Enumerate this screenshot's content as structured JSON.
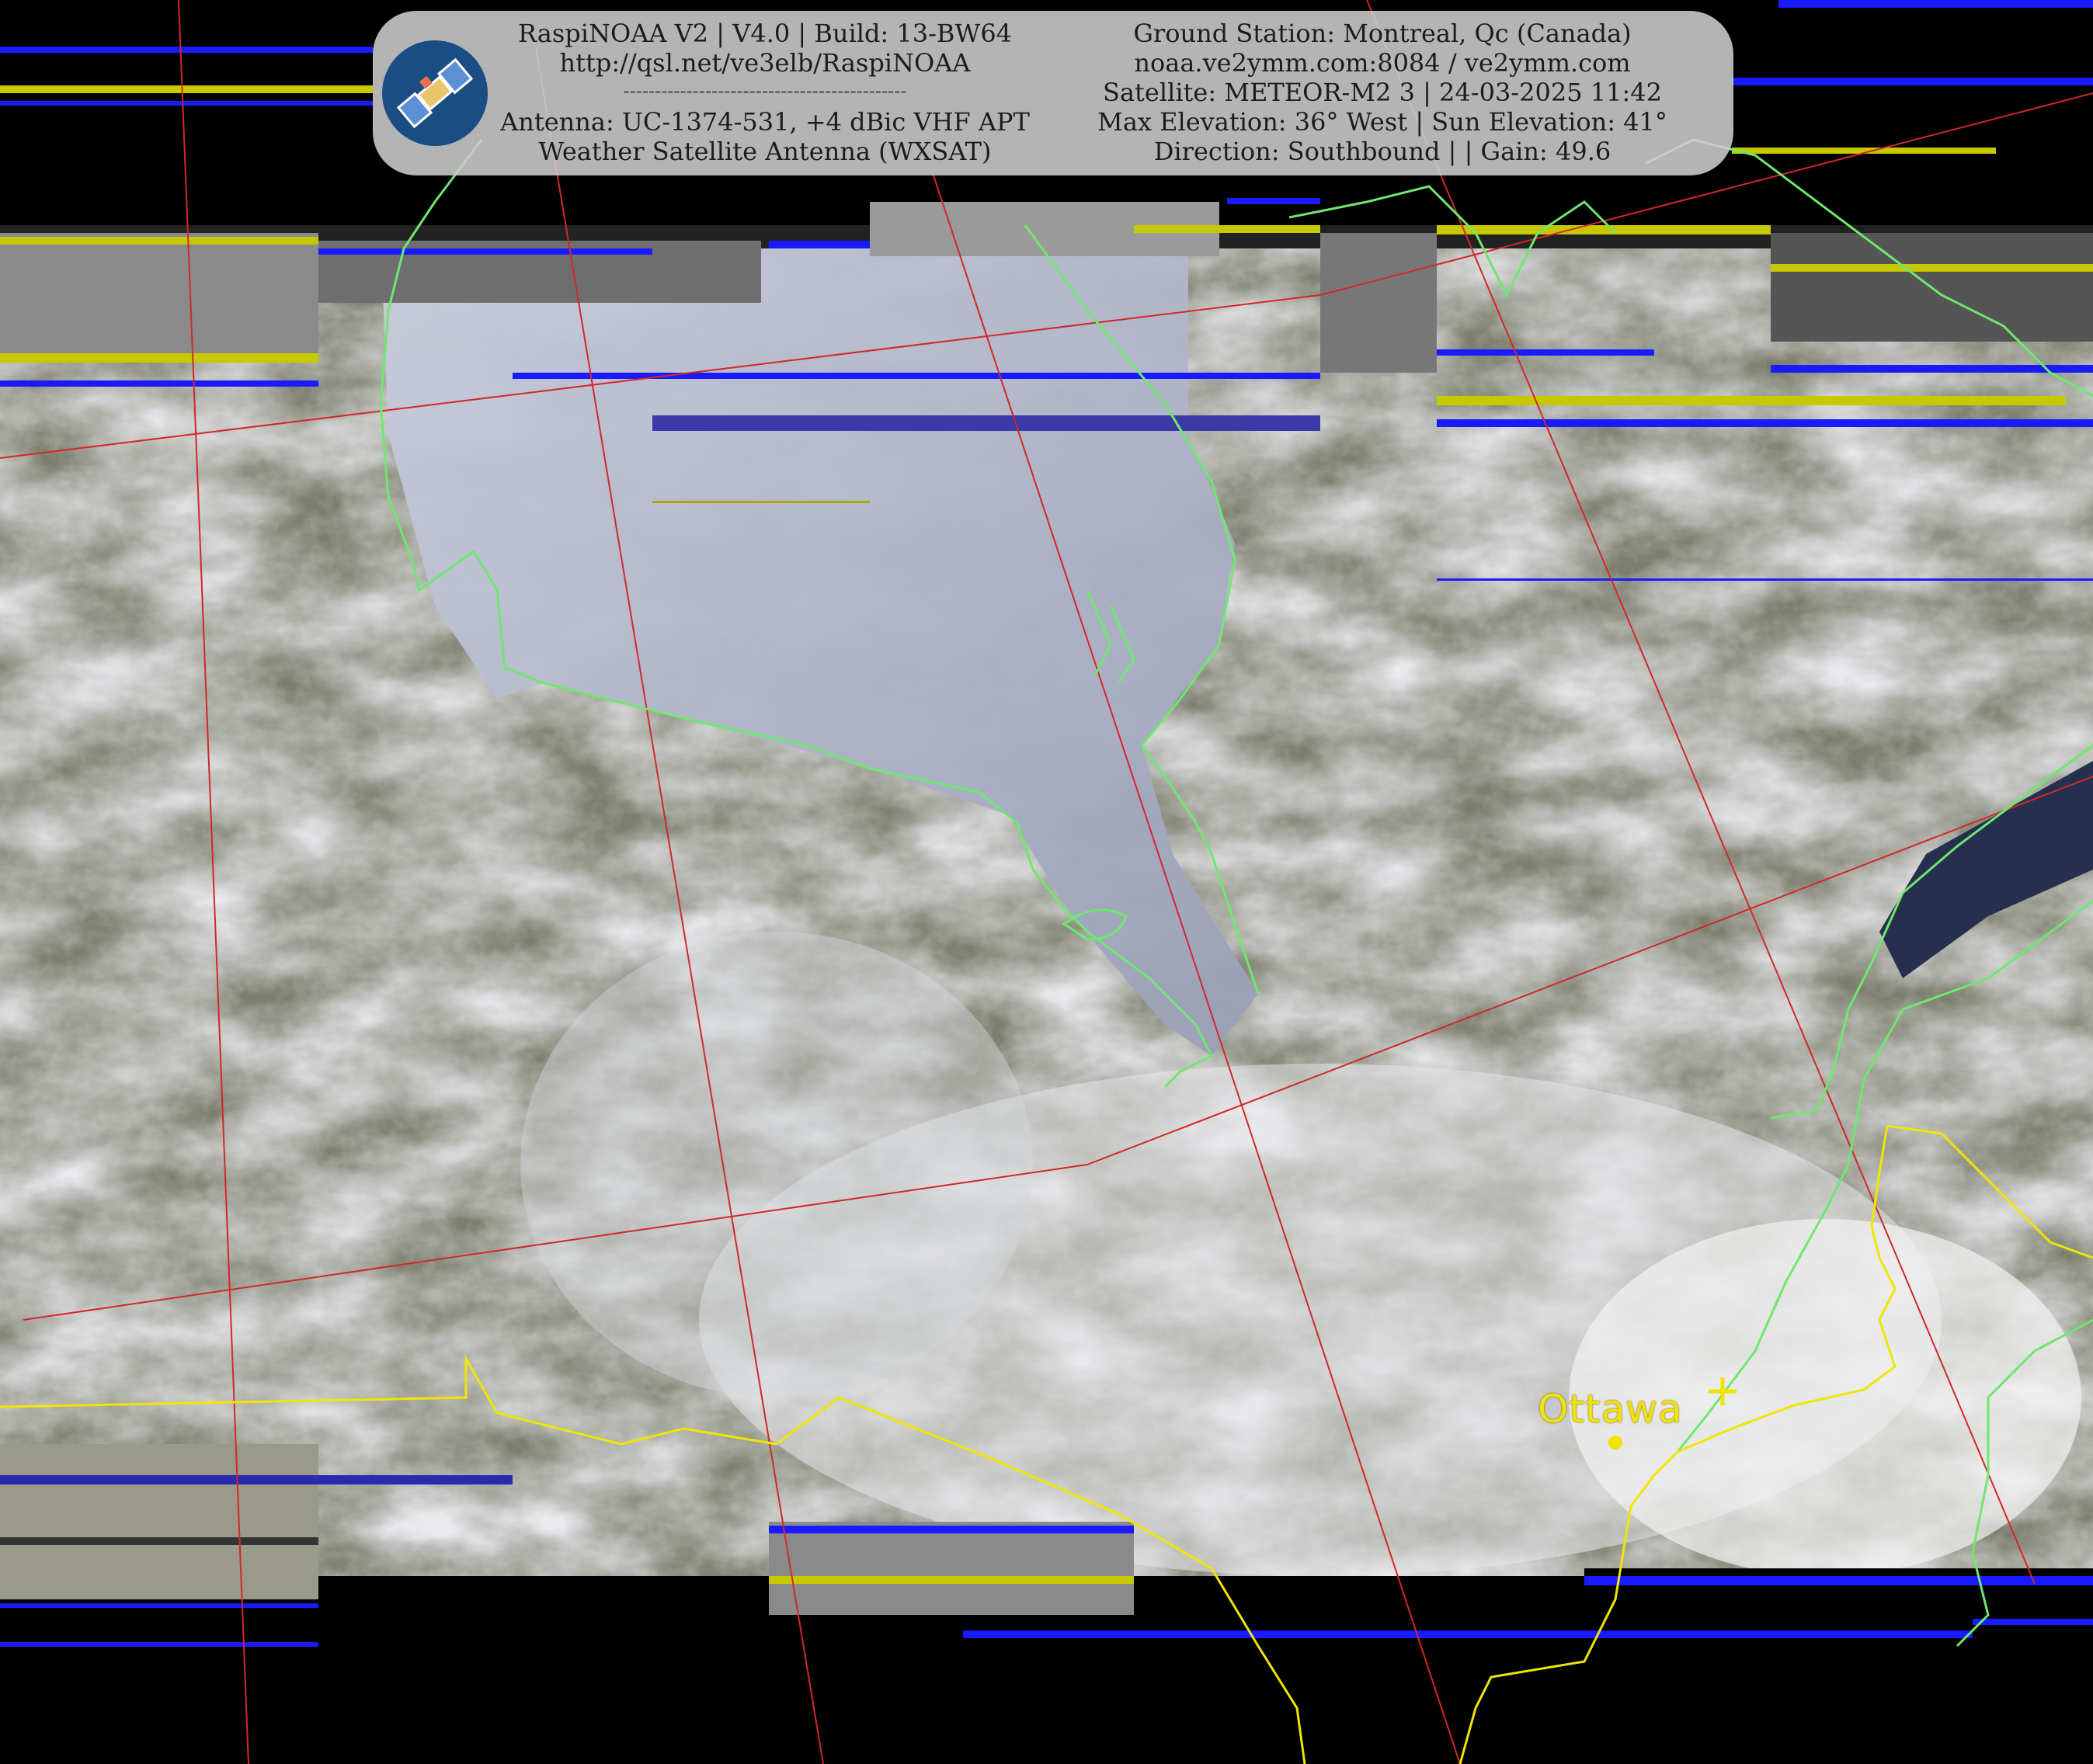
{
  "header": {
    "left_lines": [
      "RaspiNOAA V2 | V4.0 | Build: 13-BW64",
      "http://qsl.net/ve3elb/RaspiNOAA",
      "---------------------------------------------",
      "Antenna: UC-1374-531, +4 dBic VHF APT",
      "Weather Satellite Antenna (WXSAT)"
    ],
    "right_lines": [
      "Ground Station: Montreal, Qc (Canada)",
      "noaa.ve2ymm.com:8084 / ve2ymm.com",
      "Satellite: METEOR-M2 3 | 24-03-2025 11:42",
      "Max Elevation: 36° West | Sun Elevation: 41°",
      "Direction: Southbound | | Gain: 49.6"
    ],
    "logo_icon": "satellite-icon"
  },
  "map": {
    "city_label": "Ottawa",
    "colors": {
      "coastline": "#6ee86e",
      "border": "#f0e600",
      "graticule": "#d22828",
      "city_marker": "#f2e200"
    }
  }
}
